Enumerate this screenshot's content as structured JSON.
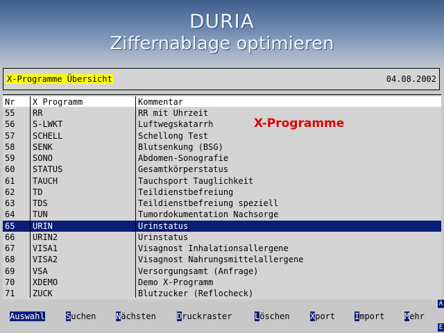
{
  "app": {
    "title": "DURIA",
    "subtitle": "Ziffernablage optimieren"
  },
  "header": {
    "label": "X-Programme Übersicht",
    "date": "04.08.2002"
  },
  "overlay_label": "X-Programme",
  "table": {
    "columns": [
      "Nr",
      "X Programm",
      "Kommentar"
    ],
    "selected_nr": "65",
    "rows": [
      [
        "55",
        "RR",
        "RR mit Uhrzeit"
      ],
      [
        "56",
        "S-LWKT",
        "Luftwegskatarrh"
      ],
      [
        "57",
        "SCHELL",
        "Schellong Test"
      ],
      [
        "58",
        "SENK",
        "Blutsenkung (BSG)"
      ],
      [
        "59",
        "SONO",
        "Abdomen-Sonografie"
      ],
      [
        "60",
        "STATUS",
        "Gesamtkörperstatus"
      ],
      [
        "61",
        "TAUCH",
        "Tauchsport Tauglichkeit"
      ],
      [
        "62",
        "TD",
        "Teildienstbefreiung"
      ],
      [
        "63",
        "TDS",
        "Teildienstbefreiung speziell"
      ],
      [
        "64",
        "TUN",
        "Tumordokumentation Nachsorge"
      ],
      [
        "65",
        "URIN",
        "Urinstatus"
      ],
      [
        "66",
        "URIN2",
        "Urinstatus"
      ],
      [
        "67",
        "VISA1",
        "Visagnost Inhalationsallergene"
      ],
      [
        "68",
        "VISA2",
        "Visagnost Nahrungsmittelallergene"
      ],
      [
        "69",
        "VSA",
        "Versorgungsamt (Anfrage)"
      ],
      [
        "70",
        "XDEMO",
        "Demo X-Programm"
      ],
      [
        "71",
        "ZUCK",
        "Blutzucker (Reflocheck)"
      ]
    ]
  },
  "menu": [
    {
      "hotkey": "A",
      "rest": "uswahl",
      "active": true
    },
    {
      "hotkey": "S",
      "rest": "uchen",
      "active": false
    },
    {
      "hotkey": "N",
      "rest": "ächsten",
      "active": false
    },
    {
      "hotkey": "D",
      "rest": "ruckraster",
      "active": false
    },
    {
      "hotkey": "L",
      "rest": "öschen",
      "active": false
    },
    {
      "hotkey": "X",
      "rest": "port",
      "active": false
    },
    {
      "hotkey": "I",
      "rest": "mport",
      "active": false
    },
    {
      "hotkey": "M",
      "rest": "ehr",
      "active": false
    }
  ],
  "side_buttons": [
    "A",
    "E"
  ]
}
